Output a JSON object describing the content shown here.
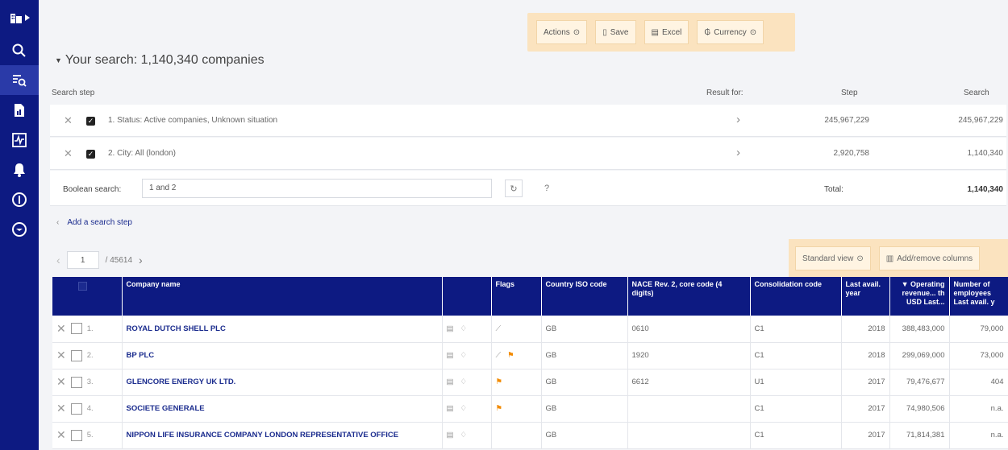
{
  "toolbar": {
    "actions_label": "Actions",
    "save_label": "Save",
    "excel_label": "Excel",
    "currency_label": "Currency"
  },
  "search": {
    "title": "Your search: 1,140,340 companies",
    "headers": {
      "step": "Search step",
      "result_for": "Result for:",
      "step_col": "Step",
      "search_col": "Search"
    },
    "steps": [
      {
        "label": "1. Status: Active companies, Unknown situation",
        "step_count": "245,967,229",
        "search_count": "245,967,229"
      },
      {
        "label": "2. City: All (london)",
        "step_count": "2,920,758",
        "search_count": "1,140,340"
      }
    ],
    "boolean_label": "Boolean search:",
    "boolean_value": "1 and 2",
    "total_label": "Total:",
    "total_value": "1,140,340",
    "add_step_label": "Add a search step"
  },
  "view": {
    "standard_view_label": "Standard view",
    "add_remove_label": "Add/remove columns"
  },
  "pager": {
    "current_page": "1",
    "total_pages": "/ 45614"
  },
  "table": {
    "headers": {
      "company": "Company name",
      "flags": "Flags",
      "country": "Country ISO code",
      "nace": "NACE Rev. 2, core code (4 digits)",
      "consolidation": "Consolidation code",
      "last_year": "Last avail. year",
      "revenue": "▼ Operating revenue... th USD Last...",
      "employees": "Number of employees Last avail. y"
    },
    "rows": [
      {
        "idx": "1.",
        "name": "ROYAL DUTCH SHELL PLC",
        "chart": true,
        "flag": false,
        "country": "GB",
        "nace": "0610",
        "consolidation": "C1",
        "year": "2018",
        "revenue": "388,483,000",
        "employees": "79,000"
      },
      {
        "idx": "2.",
        "name": "BP PLC",
        "chart": true,
        "flag": true,
        "country": "GB",
        "nace": "1920",
        "consolidation": "C1",
        "year": "2018",
        "revenue": "299,069,000",
        "employees": "73,000"
      },
      {
        "idx": "3.",
        "name": "GLENCORE ENERGY UK LTD.",
        "chart": false,
        "flag": true,
        "country": "GB",
        "nace": "6612",
        "consolidation": "U1",
        "year": "2017",
        "revenue": "79,476,677",
        "employees": "404"
      },
      {
        "idx": "4.",
        "name": "SOCIETE GENERALE",
        "chart": false,
        "flag": true,
        "country": "GB",
        "nace": "",
        "consolidation": "C1",
        "year": "2017",
        "revenue": "74,980,506",
        "employees": "n.a."
      },
      {
        "idx": "5.",
        "name": "NIPPON LIFE INSURANCE COMPANY LONDON REPRESENTATIVE OFFICE",
        "chart": false,
        "flag": false,
        "country": "GB",
        "nace": "",
        "consolidation": "C1",
        "year": "2017",
        "revenue": "71,814,381",
        "employees": "n.a."
      }
    ]
  },
  "colors": {
    "sidebar": "#0d1a82",
    "accent_panel": "#fbe3bf",
    "flag": "#f28a00",
    "link": "#1b2c8e"
  }
}
